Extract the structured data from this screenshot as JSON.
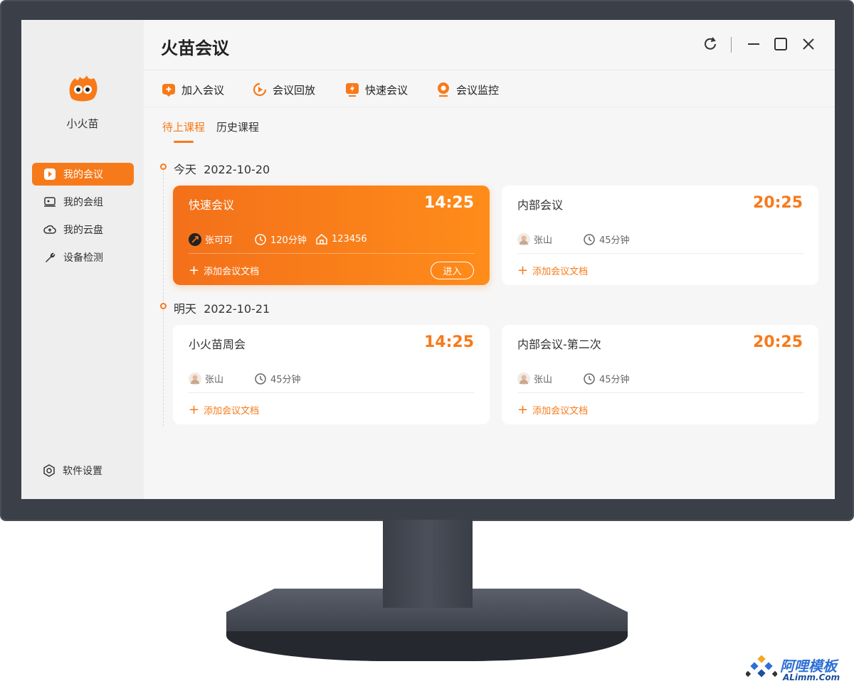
{
  "app": {
    "title": "火苗会议",
    "brand": "小火苗"
  },
  "sidebar": {
    "items": [
      {
        "label": "我的会议",
        "icon": "meeting-icon",
        "active": true
      },
      {
        "label": "我的会组",
        "icon": "group-icon",
        "active": false
      },
      {
        "label": "我的云盘",
        "icon": "cloud-upload-icon",
        "active": false
      },
      {
        "label": "设备检测",
        "icon": "wrench-icon",
        "active": false
      }
    ],
    "settings_label": "软件设置"
  },
  "toolbar": {
    "items": [
      {
        "label": "加入会议",
        "icon": "join-meeting-icon"
      },
      {
        "label": "会议回放",
        "icon": "replay-icon"
      },
      {
        "label": "快速会议",
        "icon": "quick-meeting-icon"
      },
      {
        "label": "会议监控",
        "icon": "monitor-icon"
      }
    ]
  },
  "tabs": [
    {
      "label": "待上课程",
      "active": true
    },
    {
      "label": "历史课程",
      "active": false
    }
  ],
  "days": [
    {
      "label": "今天",
      "date": "2022-10-20",
      "cards": [
        {
          "title": "快速会议",
          "time": "14:25",
          "host": "张可可",
          "duration": "120分钟",
          "room": "123456",
          "add_doc": "添加会议文档",
          "enter": "进入",
          "highlight": true
        },
        {
          "title": "内部会议",
          "time": "20:25",
          "host": "张山",
          "duration": "45分钟",
          "add_doc": "添加会议文档",
          "highlight": false
        }
      ]
    },
    {
      "label": "明天",
      "date": "2022-10-21",
      "cards": [
        {
          "title": "小火苗周会",
          "time": "14:25",
          "host": "张山",
          "duration": "45分钟",
          "add_doc": "添加会议文档",
          "highlight": false
        },
        {
          "title": "内部会议-第二次",
          "time": "20:25",
          "host": "张山",
          "duration": "45分钟",
          "add_doc": "添加会议文档",
          "highlight": false
        }
      ]
    }
  ],
  "watermark": {
    "cn": "阿哩模板",
    "en": "ALimm.Com"
  },
  "colors": {
    "accent": "#f77a1a",
    "sidebar_bg": "#eeeeee",
    "screen_bg": "#f6f6f6"
  }
}
